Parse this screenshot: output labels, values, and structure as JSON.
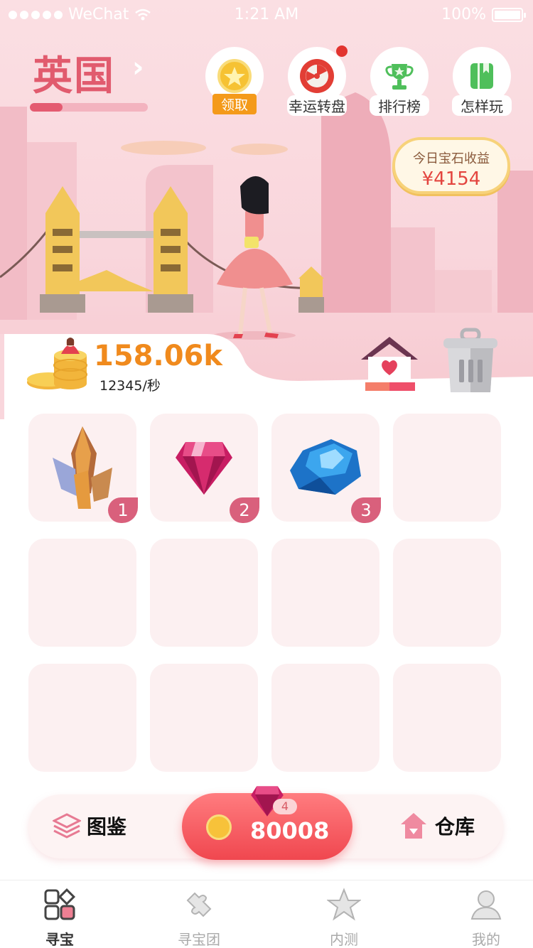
{
  "status_bar": {
    "carrier": "WeChat",
    "time": "1:21 AM",
    "battery": "100%"
  },
  "header": {
    "country": "英国",
    "progress": 0.28
  },
  "top_buttons": [
    {
      "label": "领取",
      "icon": "star-coin-icon"
    },
    {
      "label": "幸运转盘",
      "icon": "lucky-wheel-icon"
    },
    {
      "label": "排行榜",
      "icon": "trophy-icon"
    },
    {
      "label": "怎样玩",
      "icon": "book-icon"
    }
  ],
  "income": {
    "title": "今日宝石收益",
    "value": "¥4154"
  },
  "coins": {
    "total": "158.06k",
    "rate": "12345/秒"
  },
  "grid": {
    "items": [
      {
        "gem": "amber-crystal",
        "level": "1"
      },
      {
        "gem": "pink-diamond",
        "level": "2"
      },
      {
        "gem": "blue-sapphire",
        "level": "3"
      }
    ]
  },
  "bottom_bar": {
    "left_label": "图鉴",
    "buy_price": "80008",
    "buy_level": "4",
    "right_label": "仓库"
  },
  "tabs": [
    {
      "label": "寻宝",
      "active": true
    },
    {
      "label": "寻宝团",
      "active": false
    },
    {
      "label": "内测",
      "active": false
    },
    {
      "label": "我的",
      "active": false
    }
  ],
  "colors": {
    "accent": "#e45b71",
    "gold": "#f08a1d",
    "buy": "#f0474f"
  }
}
